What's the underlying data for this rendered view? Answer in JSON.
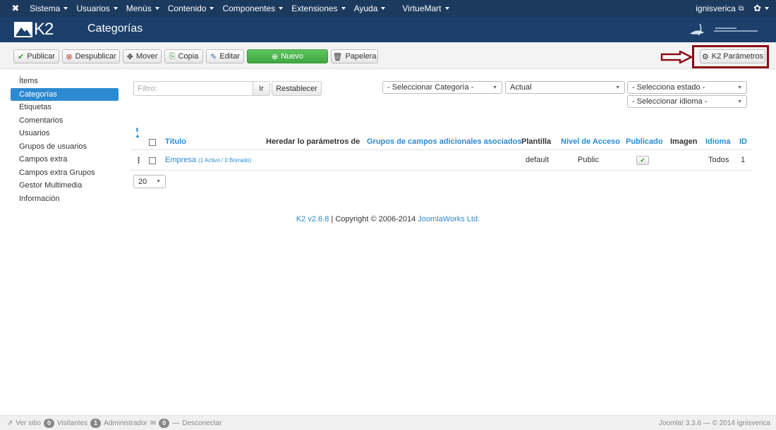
{
  "topbar": {
    "menu": [
      {
        "label": "Sistema",
        "caret": true
      },
      {
        "label": "Usuarios",
        "caret": true
      },
      {
        "label": "Menús",
        "caret": true
      },
      {
        "label": "Contenido",
        "caret": true
      },
      {
        "label": "Componentes",
        "caret": true
      },
      {
        "label": "Extensiones",
        "caret": true
      },
      {
        "label": "Ayuda",
        "caret": true
      },
      {
        "label": "VirtueMart",
        "caret": true
      }
    ],
    "user": "ignisverica"
  },
  "header": {
    "title": "Categorías",
    "logo_text": "K2"
  },
  "toolbar": {
    "publish": "Publicar",
    "unpublish": "Despublicar",
    "move": "Mover",
    "copy": "Copia",
    "edit": "Editar",
    "new": "Nuevo",
    "trash": "Papelera",
    "params": "K2 Parámetros"
  },
  "sidebar": {
    "items": [
      {
        "label": "Ítems",
        "active": false
      },
      {
        "label": "Categorías",
        "active": true
      },
      {
        "label": "Etiquetas",
        "active": false
      },
      {
        "label": "Comentarios",
        "active": false
      },
      {
        "label": "Usuarios",
        "active": false
      },
      {
        "label": "Grupos de usuarios",
        "active": false
      },
      {
        "label": "Campos extra",
        "active": false
      },
      {
        "label": "Campos extra Grupos",
        "active": false
      },
      {
        "label": "Gestor Multimedia",
        "active": false
      },
      {
        "label": "Información",
        "active": false
      }
    ]
  },
  "filters": {
    "search_placeholder": "Filtro:",
    "go": "Ir",
    "reset": "Restablecer",
    "category": "- Seleccionar Categoría -",
    "state": "Actual",
    "status": "- Selecciona estado -",
    "language": "- Seleccionar idioma -"
  },
  "table": {
    "headers": {
      "title": "Título",
      "inherit": "Heredar lo parámetros de",
      "extra_groups": "Grupos de campos adicionales asociados",
      "template": "Plantilla",
      "access": "Nivel de Acceso",
      "published": "Publicado",
      "image": "Imagen",
      "language": "Idioma",
      "id": "ID"
    },
    "rows": [
      {
        "title": "Empresa",
        "counts": "(1 Activo / 0 Borrado)",
        "template": "default",
        "access": "Public",
        "published": true,
        "language": "Todos",
        "id": "1"
      }
    ]
  },
  "pagination": {
    "limit": "20"
  },
  "copyright": {
    "version": "K2 v2.6.8",
    "text": " | Copyright © 2006-2014 ",
    "company": "JoomlaWorks Ltd."
  },
  "footer": {
    "view_site": "Ver sitio",
    "visitors_count": "0",
    "visitors": "Visitantes",
    "admin_count": "1",
    "admin": "Administrador",
    "messages_count": "0",
    "logout": "Desconectar",
    "right": "Joomla! 3.3.6 — © 2014 ignisverica"
  },
  "colors": {
    "accent": "#2a8ad0",
    "topbar": "#1b3a5e",
    "annotation": "#8b0a14",
    "new_button": "#4cb84c"
  }
}
